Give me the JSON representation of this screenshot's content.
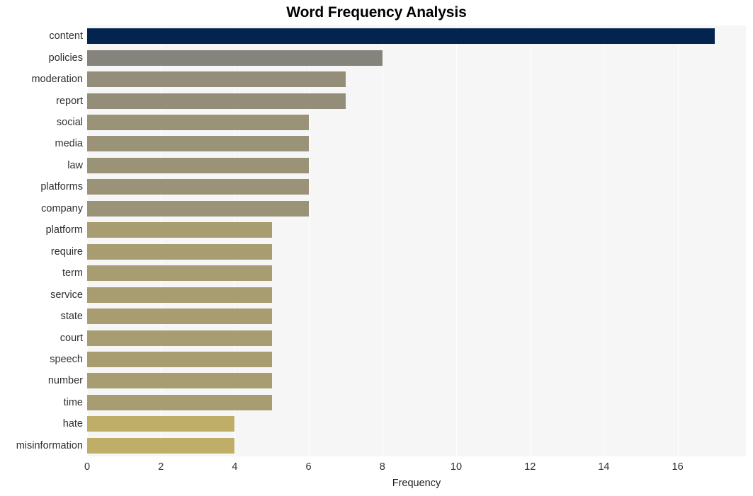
{
  "chart_data": {
    "type": "bar",
    "orientation": "horizontal",
    "title": "Word Frequency Analysis",
    "xlabel": "Frequency",
    "ylabel": "",
    "xlim": [
      0,
      17.85
    ],
    "xticks": [
      0,
      2,
      4,
      6,
      8,
      10,
      12,
      14,
      16
    ],
    "xtick_labels": [
      "0",
      "2",
      "4",
      "6",
      "8",
      "10",
      "12",
      "14",
      "16"
    ],
    "grid": "vertical",
    "legend": "none",
    "plot_background": "#f6f6f7",
    "figure_background": "#ffffff",
    "categories": [
      "content",
      "policies",
      "moderation",
      "report",
      "social",
      "media",
      "law",
      "platforms",
      "company",
      "platform",
      "require",
      "term",
      "service",
      "state",
      "court",
      "speech",
      "number",
      "time",
      "hate",
      "misinformation"
    ],
    "values": [
      17,
      8,
      7,
      7,
      6,
      6,
      6,
      6,
      6,
      5,
      5,
      5,
      5,
      5,
      5,
      5,
      5,
      5,
      4,
      4
    ],
    "bar_colors": [
      "#042450",
      "#85837b",
      "#938d7a",
      "#938d7a",
      "#9b9377",
      "#9b9377",
      "#9b9377",
      "#9b9377",
      "#9b9377",
      "#a89d70",
      "#a89d70",
      "#a89d70",
      "#a89d70",
      "#a89d70",
      "#a89d70",
      "#a89d70",
      "#a89d70",
      "#a89d70",
      "#bfae68",
      "#bfae68"
    ]
  }
}
